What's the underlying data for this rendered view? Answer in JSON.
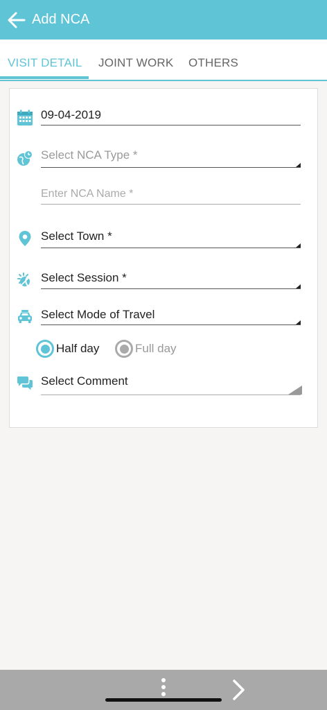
{
  "header": {
    "title": "Add NCA",
    "accent_color": "#5ec4d6"
  },
  "tabs": [
    {
      "label": "VISIT DETAIL",
      "active": true
    },
    {
      "label": "JOINT WORK",
      "active": false
    },
    {
      "label": "OTHERS",
      "active": false
    }
  ],
  "form": {
    "date": {
      "value": "09-04-2019",
      "icon": "calendar-icon"
    },
    "nca_type": {
      "label": "Select NCA Type *",
      "icon": "globe-clock-icon"
    },
    "nca_name": {
      "placeholder": "Enter NCA Name *"
    },
    "town": {
      "label": "Select Town *",
      "icon": "location-pin-icon"
    },
    "session": {
      "label": "Select Session *",
      "icon": "sun-moon-icon"
    },
    "travel_mode": {
      "label": "Select Mode of Travel",
      "icon": "car-icon"
    },
    "day_type": {
      "options": [
        {
          "label": "Half day",
          "selected": true
        },
        {
          "label": "Full day",
          "selected": false
        }
      ]
    },
    "comment": {
      "label": "Select Comment",
      "icon": "chat-bubbles-icon"
    }
  },
  "bottom_bar": {
    "more_icon": "more-vertical-icon",
    "next_icon": "chevron-right-icon"
  }
}
